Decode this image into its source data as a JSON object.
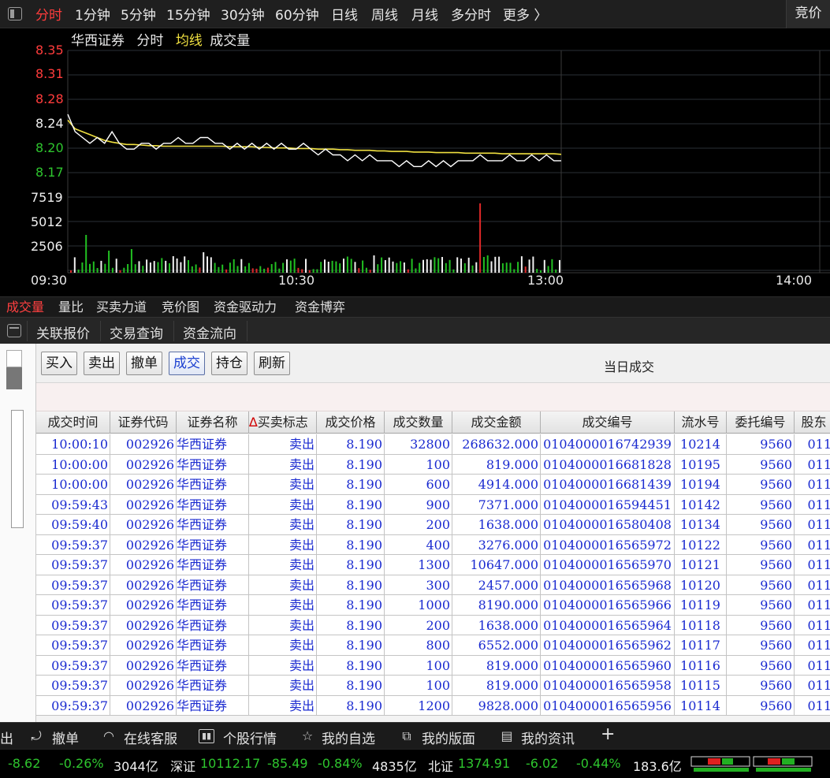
{
  "period_tabs": [
    {
      "label": "分时",
      "active": true
    },
    {
      "label": "1分钟"
    },
    {
      "label": "5分钟"
    },
    {
      "label": "15分钟"
    },
    {
      "label": "30分钟"
    },
    {
      "label": "60分钟"
    },
    {
      "label": "日线"
    },
    {
      "label": "周线"
    },
    {
      "label": "月线"
    },
    {
      "label": "多分时"
    },
    {
      "label": "更多 〉"
    }
  ],
  "bid_button": "竞价",
  "chart_header": {
    "stock_name": "华西证券",
    "mode": "分时",
    "avg_line": "均线",
    "volume": "成交量"
  },
  "chart_data": {
    "type": "line",
    "price_ticks": [
      "8.35",
      "8.31",
      "8.28",
      "8.24",
      "8.20",
      "8.17"
    ],
    "volume_ticks": [
      "7519",
      "5012",
      "2506"
    ],
    "time_ticks": [
      "09:30",
      "10:30",
      "13:00",
      "14:00"
    ],
    "ylim": [
      8.13,
      8.35
    ],
    "series": [
      {
        "values": [
          8.24,
          8.21,
          8.2,
          8.19,
          8.2,
          8.19,
          8.21,
          8.19,
          8.18,
          8.18,
          8.19,
          8.19,
          8.18,
          8.19,
          8.19,
          8.2,
          8.19,
          8.19,
          8.2,
          8.2,
          8.19,
          8.19,
          8.18,
          8.19,
          8.18,
          8.19,
          8.18,
          8.19,
          8.18,
          8.19,
          8.18,
          8.18,
          8.19,
          8.18,
          8.17,
          8.18,
          8.17,
          8.17,
          8.16,
          8.17,
          8.16,
          8.17,
          8.16,
          8.16,
          8.16,
          8.15,
          8.16,
          8.15,
          8.15,
          8.16,
          8.15,
          8.16,
          8.15,
          8.16,
          8.16,
          8.16,
          8.17,
          8.16,
          8.16,
          8.16,
          8.17,
          8.16,
          8.16,
          8.17,
          8.16,
          8.17,
          8.16,
          8.16
        ]
      },
      {
        "values": [
          8.23,
          8.215,
          8.21,
          8.205,
          8.2,
          8.195,
          8.192,
          8.19,
          8.188,
          8.188,
          8.187,
          8.186,
          8.186,
          8.185,
          8.185,
          8.185,
          8.185,
          8.185,
          8.185,
          8.185,
          8.185,
          8.185,
          8.184,
          8.184,
          8.184,
          8.184,
          8.183,
          8.183,
          8.182,
          8.182,
          8.182,
          8.181,
          8.181,
          8.181,
          8.18,
          8.18,
          8.18,
          8.179,
          8.179,
          8.178,
          8.178,
          8.178,
          8.177,
          8.177,
          8.176,
          8.176,
          8.176,
          8.175,
          8.175,
          8.175,
          8.174,
          8.174,
          8.174,
          8.174,
          8.173,
          8.173,
          8.173,
          8.173,
          8.173,
          8.172,
          8.172,
          8.172,
          8.172,
          8.172,
          8.172,
          8.172,
          8.172,
          8.171
        ]
      }
    ]
  },
  "sub_tabs": [
    "成交量",
    "量比",
    "买卖力道",
    "竞价图",
    "资金驱动力",
    "资金博弈"
  ],
  "panel_tabs": [
    "关联报价",
    "交易查询",
    "资金流向"
  ],
  "toolbar": {
    "buttons": [
      "买入",
      "卖出",
      "撤单",
      "成交",
      "持仓",
      "刷新"
    ],
    "title": "当日成交"
  },
  "table": {
    "headers": [
      "成交时间",
      "证券代码",
      "证券名称",
      "买卖标志",
      "成交价格",
      "成交数量",
      "成交金额",
      "成交编号",
      "流水号",
      "委托编号",
      "股东"
    ],
    "sort_marker": "∆",
    "rows": [
      [
        "10:00:10",
        "002926",
        "华西证券",
        "卖出",
        "8.190",
        "32800",
        "268632.000",
        "0104000016742939",
        "10214",
        "9560",
        "011"
      ],
      [
        "10:00:00",
        "002926",
        "华西证券",
        "卖出",
        "8.190",
        "100",
        "819.000",
        "0104000016681828",
        "10195",
        "9560",
        "011"
      ],
      [
        "10:00:00",
        "002926",
        "华西证券",
        "卖出",
        "8.190",
        "600",
        "4914.000",
        "0104000016681439",
        "10194",
        "9560",
        "011"
      ],
      [
        "09:59:43",
        "002926",
        "华西证券",
        "卖出",
        "8.190",
        "900",
        "7371.000",
        "0104000016594451",
        "10142",
        "9560",
        "011"
      ],
      [
        "09:59:40",
        "002926",
        "华西证券",
        "卖出",
        "8.190",
        "200",
        "1638.000",
        "0104000016580408",
        "10134",
        "9560",
        "011"
      ],
      [
        "09:59:37",
        "002926",
        "华西证券",
        "卖出",
        "8.190",
        "400",
        "3276.000",
        "0104000016565972",
        "10122",
        "9560",
        "011"
      ],
      [
        "09:59:37",
        "002926",
        "华西证券",
        "卖出",
        "8.190",
        "1300",
        "10647.000",
        "0104000016565970",
        "10121",
        "9560",
        "011"
      ],
      [
        "09:59:37",
        "002926",
        "华西证券",
        "卖出",
        "8.190",
        "300",
        "2457.000",
        "0104000016565968",
        "10120",
        "9560",
        "011"
      ],
      [
        "09:59:37",
        "002926",
        "华西证券",
        "卖出",
        "8.190",
        "1000",
        "8190.000",
        "0104000016565966",
        "10119",
        "9560",
        "011"
      ],
      [
        "09:59:37",
        "002926",
        "华西证券",
        "卖出",
        "8.190",
        "200",
        "1638.000",
        "0104000016565964",
        "10118",
        "9560",
        "011"
      ],
      [
        "09:59:37",
        "002926",
        "华西证券",
        "卖出",
        "8.190",
        "800",
        "6552.000",
        "0104000016565962",
        "10117",
        "9560",
        "011"
      ],
      [
        "09:59:37",
        "002926",
        "华西证券",
        "卖出",
        "8.190",
        "100",
        "819.000",
        "0104000016565960",
        "10116",
        "9560",
        "011"
      ],
      [
        "09:59:37",
        "002926",
        "华西证券",
        "卖出",
        "8.190",
        "100",
        "819.000",
        "0104000016565958",
        "10115",
        "9560",
        "011"
      ],
      [
        "09:59:37",
        "002926",
        "华西证券",
        "卖出",
        "8.190",
        "1200",
        "9828.000",
        "0104000016565956",
        "10114",
        "9560",
        "011"
      ]
    ]
  },
  "bottom_bar": {
    "items": [
      {
        "label": "出",
        "icon": ""
      },
      {
        "label": "撤单",
        "icon": "undo-icon"
      },
      {
        "label": "在线客服",
        "icon": "headset-icon"
      },
      {
        "label": "个股行情",
        "icon": "kline-icon"
      },
      {
        "label": "我的自选",
        "icon": "star-icon"
      },
      {
        "label": "我的版面",
        "icon": "layout-icon"
      },
      {
        "label": "我的资讯",
        "icon": "news-icon"
      }
    ],
    "add": "+"
  },
  "ticker": {
    "sh_change": "-8.62",
    "sh_pct": "-0.26%",
    "sh_amount": "3044亿",
    "sz_name": "深证",
    "sz_index": "10112.17",
    "sz_change": "-85.49",
    "sz_pct": "-0.84%",
    "sz_amount": "4835亿",
    "bz_name": "北证",
    "bz_index": "1374.91",
    "bz_change": "-6.02",
    "bz_pct": "-0.44%",
    "bz_amount": "183.6亿"
  },
  "colors": {
    "up": "#ff3c3c",
    "down": "#2ec52e",
    "price_line": "#ffffff",
    "avg_line": "#f0e040",
    "table_text": "#1a2ad0"
  }
}
